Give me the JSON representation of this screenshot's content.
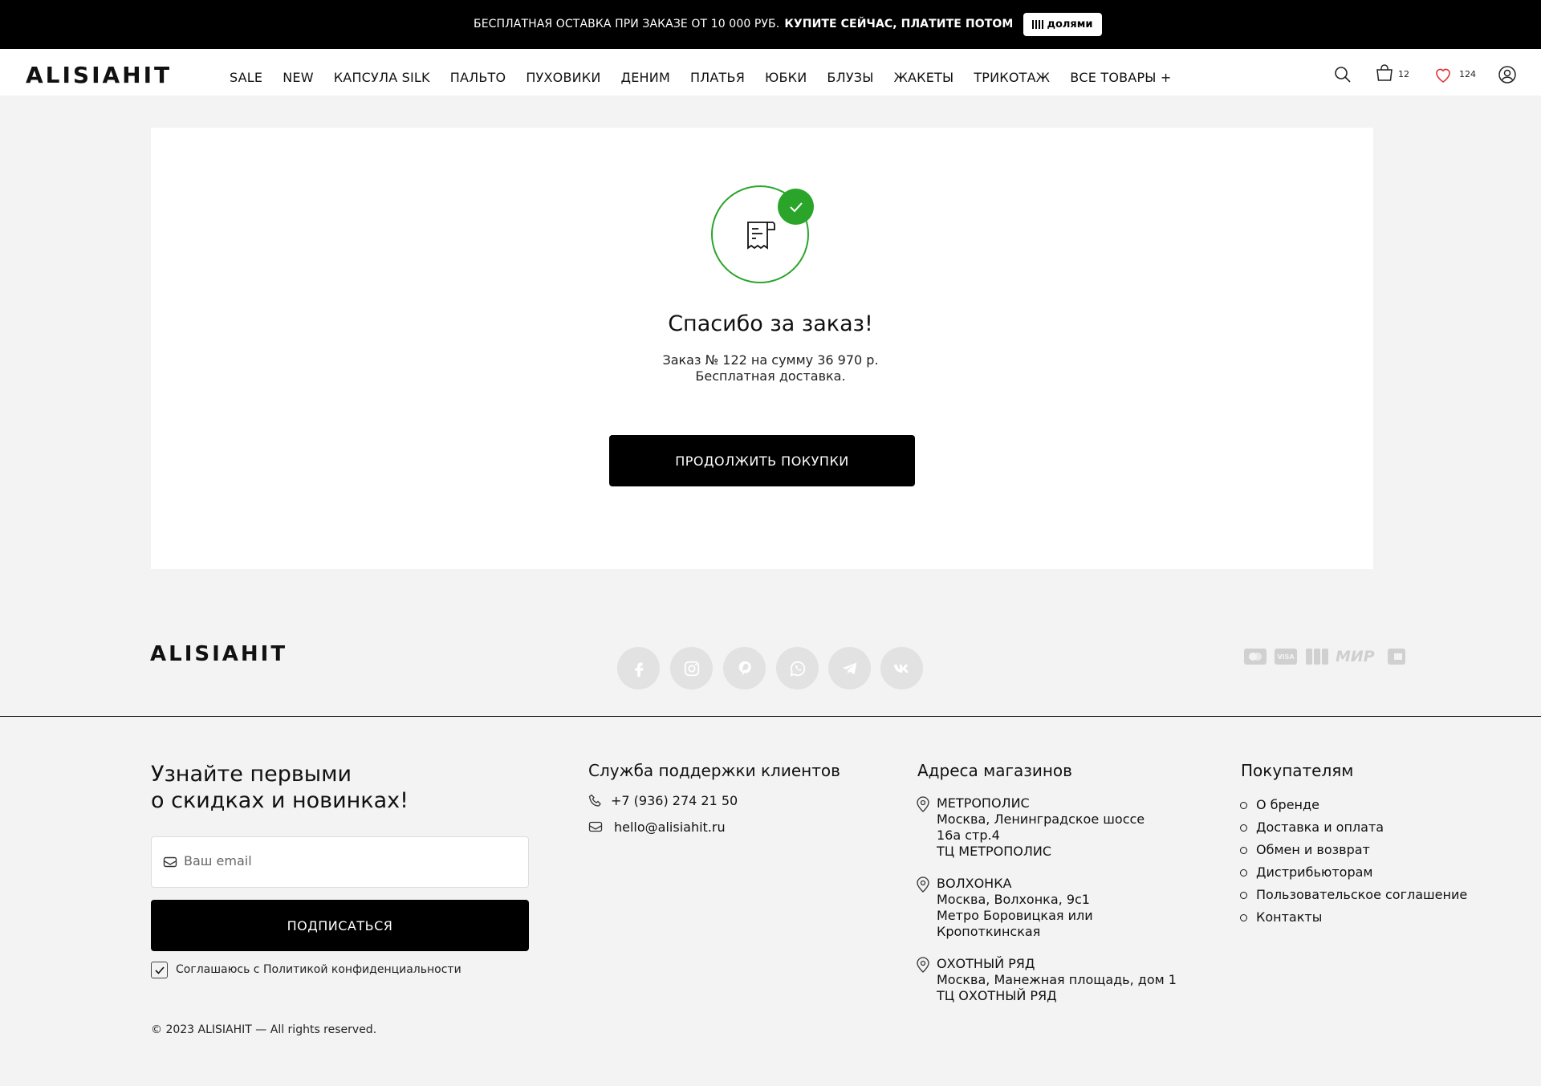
{
  "promo": {
    "text": "БЕСПЛАТНАЯ ОСТАВКА ПРИ ЗАКАЗЕ ОТ 10 000 РУБ.",
    "cta": "КУПИТЕ СЕЙЧАС, ПЛАТИТЕ ПОТОМ",
    "badge": "долями"
  },
  "header": {
    "logo": "ALISIAHIT",
    "nav": [
      "SALE",
      "NEW",
      "КАПСУЛА SILK",
      "ПАЛЬТО",
      "ПУХОВИКИ",
      "ДЕНИМ",
      "ПЛАТЬЯ",
      "ЮБКИ",
      "БЛУЗЫ",
      "ЖАКЕТЫ",
      "ТРИКОТАЖ",
      "ВСЕ ТОВАРЫ +"
    ],
    "cart_count": "12",
    "wishlist_count": "124",
    "icons": [
      "search-icon",
      "cart-icon",
      "heart-icon",
      "user-icon"
    ]
  },
  "order": {
    "title": "Спасибо за заказ!",
    "line1": "Заказ № 122 на сумму 36 970 р.",
    "line2": "Бесплатная доставка.",
    "button": "ПРОДОЛЖИТЬ ПОКУПКИ",
    "success_color": "#2aa52a"
  },
  "footer": {
    "logo": "ALISIAHIT",
    "social": [
      "facebook-icon",
      "instagram-icon",
      "pinterest-icon",
      "whatsapp-icon",
      "telegram-icon",
      "vk-icon"
    ],
    "payments": [
      "mastercard-icon",
      "visa-icon",
      "jcb-icon",
      "mir-icon",
      "card-icon"
    ],
    "payment_mir_label": "МИР",
    "payment_visa_label": "VISA",
    "subscribe": {
      "title1": "Узнайте первыми",
      "title2": "о скидках и новинках!",
      "placeholder": "Ваш email",
      "button": "ПОДПИСАТЬСЯ",
      "consent": "Соглашаюсь с Политикой конфиденциальности"
    },
    "support": {
      "title": "Служба поддержки клиентов",
      "phone": "+7 (936) 274 21 50",
      "email": "hello@alisiahit.ru"
    },
    "stores": {
      "title": "Адреса магазинов",
      "items": [
        {
          "name": "МЕТРОПОЛИС",
          "lines": [
            "Москва, Ленинградское шоссе",
            "16а стр.4",
            "ТЦ МЕТРОПОЛИС"
          ]
        },
        {
          "name": "ВОЛХОНКА",
          "lines": [
            "Москва, Волхонка, 9с1",
            "Метро Боровицкая или",
            "Кропоткинская"
          ]
        },
        {
          "name": "ОХОТНЫЙ РЯД",
          "lines": [
            "Москва, Манежная площадь, дом 1",
            "ТЦ ОХОТНЫЙ РЯД"
          ]
        }
      ]
    },
    "buyers": {
      "title": "Покупателям",
      "items": [
        "О бренде",
        "Доставка и оплата",
        "Обмен и возврат",
        "Дистрибьюторам",
        "Пользовательское соглашение",
        "Контакты"
      ]
    },
    "copyright": "© 2023 ALISIAHIT — All rights reserved."
  }
}
